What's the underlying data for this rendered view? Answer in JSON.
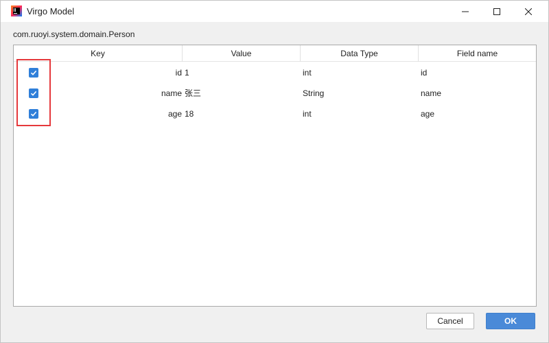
{
  "window": {
    "title": "Virgo Model",
    "app_icon": "intellij-idea-icon",
    "controls": [
      "minimize-icon",
      "maximize-icon",
      "close-icon"
    ]
  },
  "class_path": "com.ruoyi.system.domain.Person",
  "table": {
    "headers": {
      "key": "Key",
      "value": "Value",
      "type": "Data Type",
      "field": "Field name"
    },
    "rows": [
      {
        "checked": true,
        "key": "id",
        "value": "1",
        "type": "int",
        "field": "id"
      },
      {
        "checked": true,
        "key": "name",
        "value": "张三",
        "type": "String",
        "field": "name"
      },
      {
        "checked": true,
        "key": "age",
        "value": "18",
        "type": "int",
        "field": "age"
      }
    ]
  },
  "buttons": {
    "cancel": "Cancel",
    "ok": "OK"
  },
  "colors": {
    "checkbox": "#2f7fd9",
    "ok_button": "#4a8ad8",
    "highlight": "#e5383b"
  }
}
